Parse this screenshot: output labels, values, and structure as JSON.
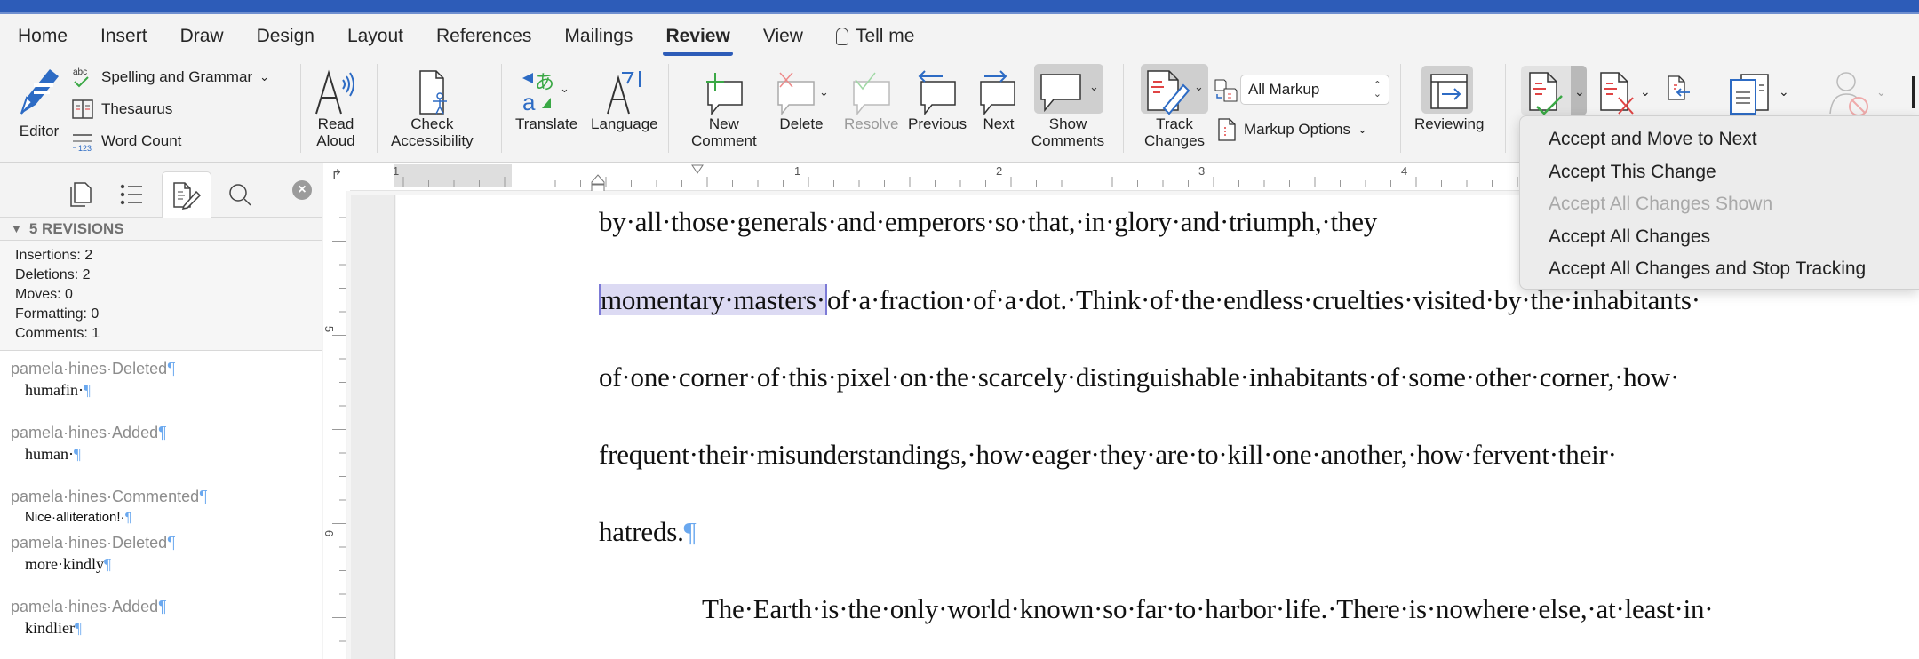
{
  "window": {
    "title_bar_color": "#2d5cb8",
    "accent": "#2d5cb8"
  },
  "tabs": [
    {
      "label": "Home"
    },
    {
      "label": "Insert"
    },
    {
      "label": "Draw"
    },
    {
      "label": "Design"
    },
    {
      "label": "Layout"
    },
    {
      "label": "References"
    },
    {
      "label": "Mailings"
    },
    {
      "label": "Review",
      "active": true
    },
    {
      "label": "View"
    }
  ],
  "tell_me": {
    "label": "Tell me",
    "icon": "lightbulb-icon"
  },
  "ribbon": {
    "editor": {
      "label": "Editor",
      "icon": "editor-pen-icon"
    },
    "proofing": [
      {
        "label": "Spelling and Grammar",
        "icon": "spelling-abc-icon",
        "has_dropdown": true
      },
      {
        "label": "Thesaurus",
        "icon": "thesaurus-book-icon"
      },
      {
        "label": "Word Count",
        "icon": "word-count-icon"
      }
    ],
    "read_aloud": {
      "label_line1": "Read",
      "label_line2": "Aloud",
      "icon": "read-aloud-icon"
    },
    "check_accessibility": {
      "label_line1": "Check",
      "label_line2": "Accessibility",
      "icon": "accessibility-icon"
    },
    "translate": {
      "label": "Translate",
      "icon": "translate-icon"
    },
    "language": {
      "label": "Language",
      "icon": "language-icon"
    },
    "new_comment": {
      "label_line1": "New",
      "label_line2": "Comment",
      "icon": "new-comment-icon"
    },
    "delete": {
      "label": "Delete",
      "icon": "delete-comment-icon"
    },
    "resolve": {
      "label": "Resolve",
      "icon": "resolve-comment-icon",
      "disabled": true
    },
    "previous": {
      "label": "Previous",
      "icon": "previous-comment-icon"
    },
    "next": {
      "label": "Next",
      "icon": "next-comment-icon"
    },
    "show_comments": {
      "label_line1": "Show",
      "label_line2": "Comments",
      "icon": "show-comments-icon",
      "pressed": true
    },
    "track_changes": {
      "label_line1": "Track",
      "label_line2": "Changes",
      "icon": "track-changes-icon",
      "pressed": true
    },
    "markup_select": {
      "value": "All Markup"
    },
    "markup_options": {
      "label": "Markup Options"
    },
    "reviewing": {
      "label": "Reviewing",
      "icon": "reviewing-pane-icon",
      "pressed": true
    },
    "accept": {
      "icon": "accept-change-icon"
    },
    "reject": {
      "icon": "reject-change-icon"
    },
    "previous_change": {
      "icon": "previous-change-icon"
    },
    "compare": {
      "icon": "compare-documents-icon"
    },
    "block_authors": {
      "icon": "block-authors-icon",
      "disabled": true
    }
  },
  "accept_menu": {
    "items": [
      {
        "label": "Accept and Move to Next",
        "enabled": true
      },
      {
        "label": "Accept This Change",
        "enabled": true
      },
      {
        "label": "Accept All Changes Shown",
        "enabled": false
      },
      {
        "label": "Accept All Changes",
        "enabled": true
      },
      {
        "label": "Accept All Changes and Stop Tracking",
        "enabled": true
      }
    ]
  },
  "sidebar": {
    "tabs": [
      {
        "name": "thumbnails",
        "icon": "pages-icon"
      },
      {
        "name": "navigation",
        "icon": "list-icon"
      },
      {
        "name": "revisions",
        "icon": "revisions-icon",
        "active": true
      },
      {
        "name": "search",
        "icon": "search-icon"
      }
    ],
    "close_glyph": "×",
    "header": "5 REVISIONS",
    "stats": [
      "Insertions: 2",
      "Deletions: 2",
      "Moves: 0",
      "Formatting: 0",
      "Comments: 1"
    ],
    "revisions": [
      {
        "author_line": "pamela·hines·Deleted",
        "text": "humafin·"
      },
      {
        "author_line": "pamela·hines·Added",
        "text": "human·"
      },
      {
        "author_line": "pamela·hines·Commented",
        "text": "Nice·alliteration!·"
      },
      {
        "author_line": "pamela·hines·Deleted",
        "text": "more·kindly"
      },
      {
        "author_line": "pamela·hines·Added",
        "text": "kindlier"
      }
    ],
    "pilcrow": "¶"
  },
  "ruler": {
    "horizontal_labels": [
      "1",
      "1",
      "2",
      "3",
      "4"
    ],
    "vertical_labels": [
      "5",
      "6"
    ],
    "tab_stop_glyph": "↱"
  },
  "document": {
    "lines": [
      {
        "text": "by·all·those·generals·and·emperors·so·that,·in·glory·and·triumph,·they"
      },
      {
        "highlight": "momentary·masters·",
        "text": "of·a·fraction·of·a·dot.·Think·of·the·endless·cruelties·visited·by·the·inhabitants·"
      },
      {
        "text": "of·one·corner·of·this·pixel·on·the·scarcely·distinguishable·inhabitants·of·some·other·corner,·how·"
      },
      {
        "text": "frequent·their·misunderstandings,·how·eager·they·are·to·kill·one·another,·how·fervent·their·"
      },
      {
        "text": "hatreds.",
        "pilcrow": "¶"
      },
      {
        "text": "The·Earth·is·the·only·world·known·so·far·to·harbor·life.·There·is·nowhere·else,·at·least·in·",
        "indent": true
      }
    ]
  }
}
